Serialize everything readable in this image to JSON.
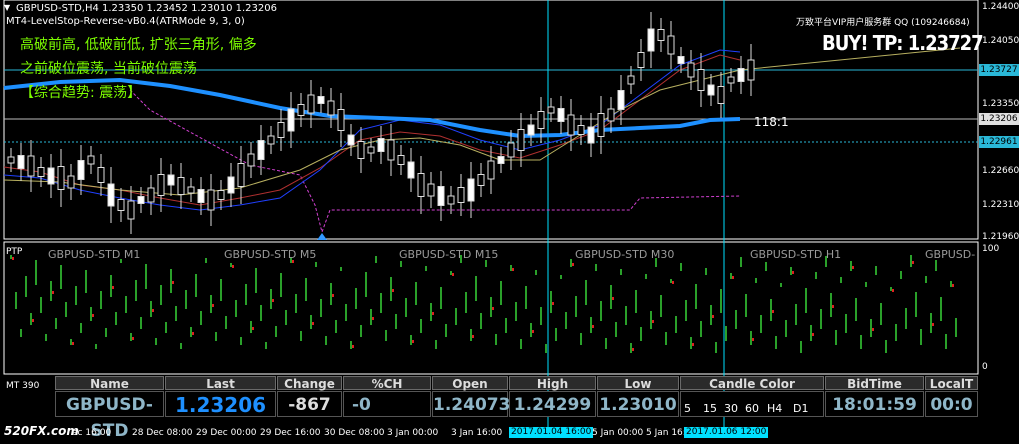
{
  "header": {
    "symbol_line": "GBPUSD-STD,H4  1.23350 1.23452 1.23010 1.23206",
    "indicator_line": "MT4-LevelStop-Reverse-vB0.4(ATRMode 9, 3, 0)"
  },
  "annotations": {
    "cn_line1": "高破前高, 低破前低, 扩张三角形, 偏多",
    "cn_line2": "之前破位震荡, 当前破位震荡",
    "cn_line3": "【综合趋势: 震荡】",
    "vip": "万致平台VIP用户服务群 QQ (109246684)",
    "signal": "BUY!  TP: 1.23727",
    "ratio": "118:1"
  },
  "price_axis": [
    "1.24400",
    "1.24050",
    "1.23700",
    "1.23350",
    "1.23000",
    "1.22660",
    "1.22310",
    "1.21960"
  ],
  "price_markers": {
    "tp": "1.23727",
    "current": "1.23206",
    "level": "1.22961"
  },
  "subwindow": {
    "label": "PTP",
    "panels": [
      "GBPUSD-STD M1",
      "GBPUSD-STD M5",
      "GBPUSD-STD M15",
      "GBPUSD-STD M30",
      "GBPUSD-STD H1",
      "GBPUSD-"
    ],
    "axis_top": "100",
    "axis_bottom": "0"
  },
  "table": {
    "label": "MT 390",
    "headers": [
      "Name",
      "Last",
      "Change",
      "%CH",
      "Open",
      "High",
      "Low",
      "Candle Color",
      "BidTime",
      "LocalT"
    ],
    "name": "GBPUSD-STD",
    "last": "1.23206",
    "change": "-867",
    "pch": "-0",
    "open": "1.24073",
    "high": "1.24299",
    "low": "1.23010",
    "tf_labels": [
      "5",
      "15",
      "30",
      "60",
      "H4",
      "D1"
    ],
    "bid_time": "18:01:59",
    "local_time": "00:0"
  },
  "time_axis": [
    "ec 16:00",
    "28 Dec 08:00",
    "29 Dec 00:00",
    "29 Dec 16:00",
    "30 Dec 08:00",
    "3 Jan 00:00",
    "3 Jan 16:00",
    "2017.01.04 16:00",
    "5 Jan 00:00",
    "5 Jan 16:00",
    "2017.01.06 12:00"
  ],
  "watermark": "520FX.com",
  "colors": {
    "buy_green": "#7cfc00",
    "ma_blue": "#1e90ff",
    "crosshair": "#00e0ff",
    "tp_line": "#2ab8d8"
  }
}
